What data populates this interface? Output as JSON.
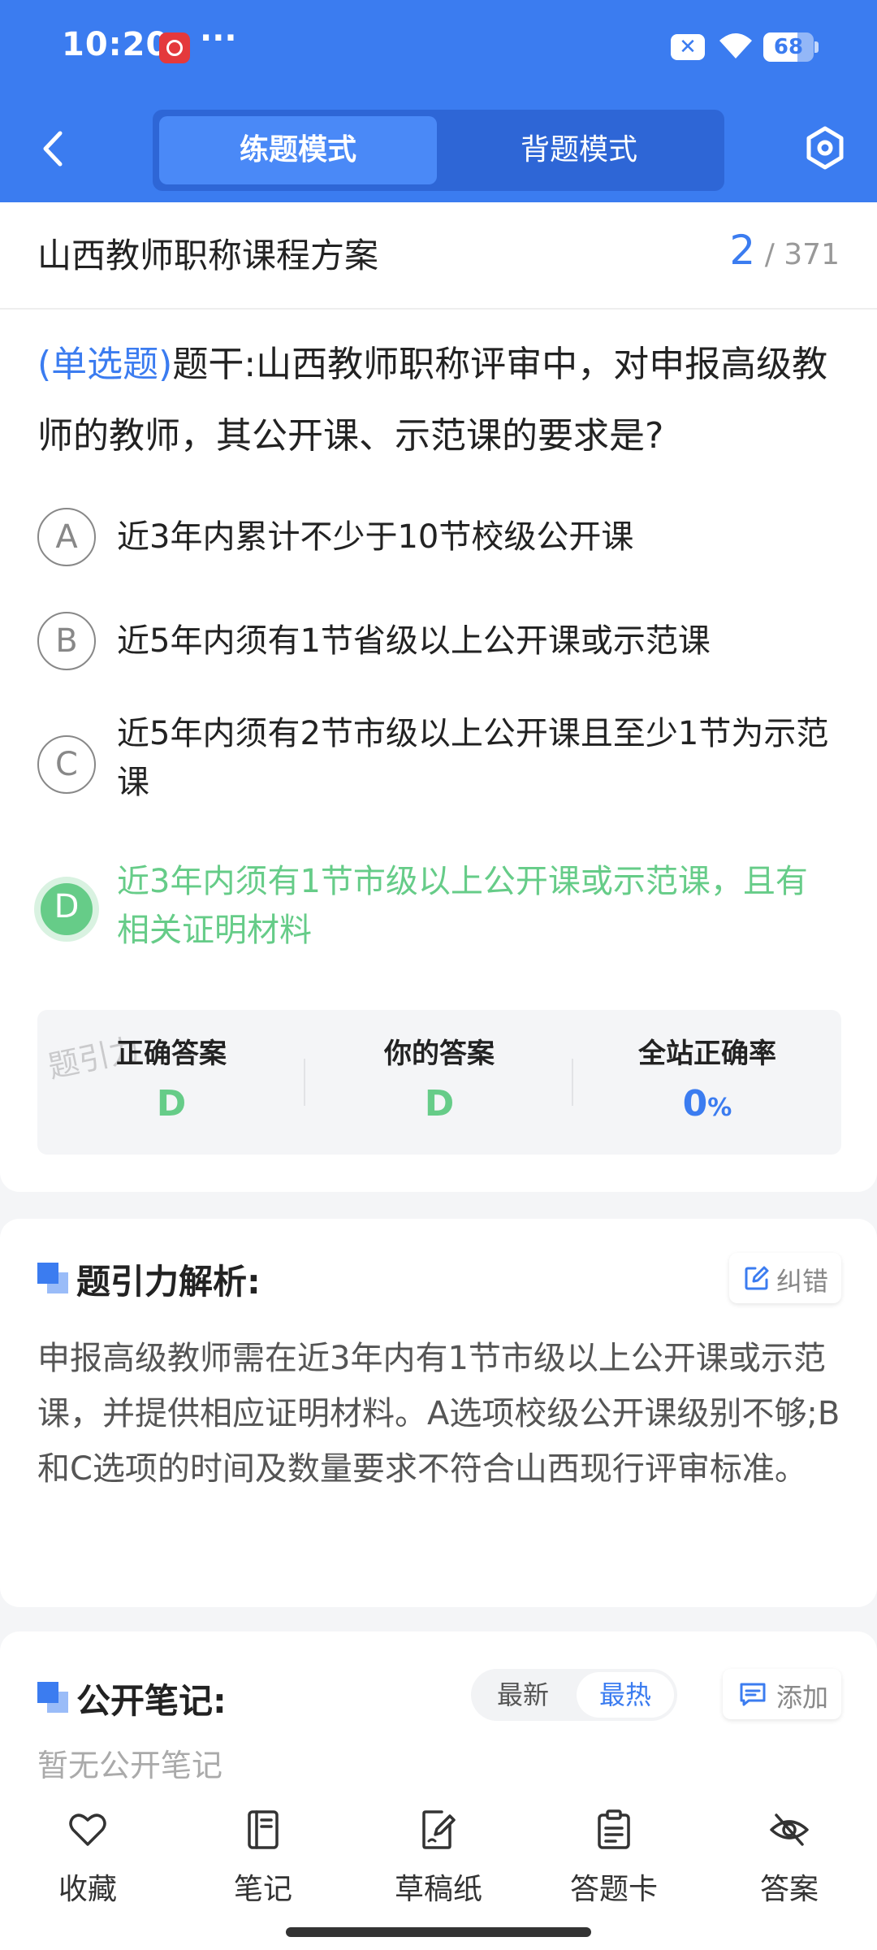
{
  "status_bar": {
    "time": "10:20",
    "more": "···",
    "sim_icon": "sim-x-icon",
    "battery_level": 68,
    "battery_text": "68"
  },
  "nav": {
    "tabs": [
      {
        "label": "练题模式",
        "active": true
      },
      {
        "label": "背题模式",
        "active": false
      }
    ]
  },
  "question": {
    "course": "山西教师职称课程方案",
    "current": "2",
    "separator": "/",
    "total": "371",
    "type": "(单选题)",
    "stem": "题干:山西教师职称评审中，对申报高级教师的教师，其公开课、示范课的要求是?",
    "options": [
      {
        "letter": "A",
        "text": "近3年内累计不少于10节校级公开课"
      },
      {
        "letter": "B",
        "text": "近5年内须有1节省级以上公开课或示范课"
      },
      {
        "letter": "C",
        "text": "近5年内须有2节市级以上公开课且至少1节为示范课"
      },
      {
        "letter": "D",
        "text": "近3年内须有1节市级以上公开课或示范课，且有相关证明材料"
      }
    ],
    "correct_option": "D"
  },
  "stats": {
    "correct_label": "正确答案",
    "correct_value": "D",
    "yours_label": "你的答案",
    "yours_value": "D",
    "rate_label": "全站正确率",
    "rate_value": "0",
    "rate_unit": "%",
    "watermark": "题引力"
  },
  "analysis": {
    "title": "题引力解析:",
    "report_label": "纠错",
    "text": "申报高级教师需在近3年内有1节市级以上公开课或示范课，并提供相应证明材料。A选项校级公开课级别不够;B和C选项的时间及数量要求不符合山西现行评审标准。"
  },
  "notes": {
    "title": "公开笔记:",
    "sort_latest": "最新",
    "sort_hot": "最热",
    "add_label": "添加",
    "empty": "暂无公开笔记"
  },
  "bottom_bar": {
    "items": [
      {
        "label": "收藏",
        "icon": "heart-icon"
      },
      {
        "label": "笔记",
        "icon": "notebook-icon"
      },
      {
        "label": "草稿纸",
        "icon": "draft-icon"
      },
      {
        "label": "答题卡",
        "icon": "clipboard-icon"
      },
      {
        "label": "答案",
        "icon": "eye-off-icon"
      }
    ]
  },
  "colors": {
    "primary": "#3b7cf0",
    "correct": "#66cc88",
    "muted": "#999999"
  }
}
